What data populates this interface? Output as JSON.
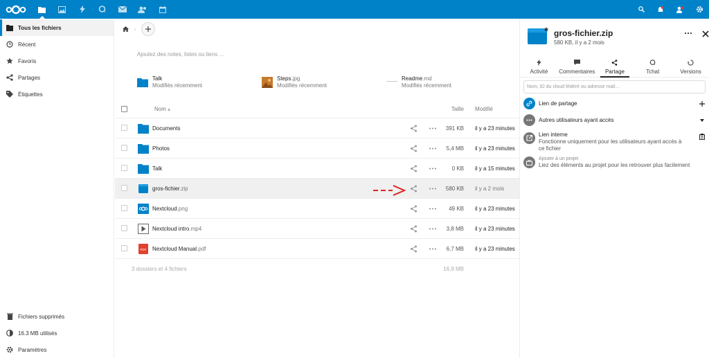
{
  "topbar": {
    "apps": [
      "files-icon",
      "photos-icon",
      "activity-icon",
      "talk-icon",
      "mail-icon",
      "contacts-icon",
      "calendar-icon"
    ],
    "colors": {
      "bar": "#0082c9"
    }
  },
  "sidebar": {
    "items": [
      {
        "label": "Tous les fichiers",
        "icon": "folder-icon"
      },
      {
        "label": "Récent",
        "icon": "clock-icon"
      },
      {
        "label": "Favoris",
        "icon": "star-icon"
      },
      {
        "label": "Partages",
        "icon": "share-icon"
      },
      {
        "label": "Étiquettes",
        "icon": "tag-icon"
      }
    ],
    "bottom": [
      {
        "label": "Fichiers supprimés",
        "icon": "trash-icon"
      },
      {
        "label": "16.3 MB utilisés",
        "icon": "quota-icon"
      },
      {
        "label": "Paramètres",
        "icon": "gear-icon"
      }
    ]
  },
  "main": {
    "notes_placeholder": "Ajoutez des notes, listes ou liens …",
    "recent": [
      {
        "name": "Talk",
        "ext": "",
        "sub": "Modifiés récemment"
      },
      {
        "name": "Steps",
        "ext": ".jpg",
        "sub": "Modifiés récemment"
      },
      {
        "name": "Readme",
        "ext": ".md",
        "sub": "Modifiés récemment"
      }
    ],
    "headers": {
      "name": "Nom",
      "size": "Taille",
      "modified": "Modifié"
    },
    "files": [
      {
        "name": "Documents",
        "ext": "",
        "size": "391 KB",
        "modified": "il y a 23 minutes"
      },
      {
        "name": "Photos",
        "ext": "",
        "size": "5,4 MB",
        "modified": "il y a 23 minutes"
      },
      {
        "name": "Talk",
        "ext": "",
        "size": "0 KB",
        "modified": "il y a 15 minutes"
      },
      {
        "name": "gros-fichier",
        "ext": ".zip",
        "size": "580 KB",
        "modified": "il y a 2 mois"
      },
      {
        "name": "Nextcloud",
        "ext": ".png",
        "size": "49 KB",
        "modified": "il y a 23 minutes"
      },
      {
        "name": "Nextcloud intro",
        "ext": ".mp4",
        "size": "3,8 MB",
        "modified": "il y a 23 minutes"
      },
      {
        "name": "Nextcloud Manual",
        "ext": ".pdf",
        "size": "6,7 MB",
        "modified": "il y a 23 minutes"
      }
    ],
    "summary": {
      "label": "3 dossiers et 4 fichiers",
      "size": "16,9 MB"
    }
  },
  "details": {
    "title": "gros-fichier.zip",
    "subtitle": "580 KB, il y a 2 mois",
    "tabs": [
      "Activité",
      "Commentaires",
      "Partage",
      "Tchat",
      "Versions"
    ],
    "share_placeholder": "Nom, ID du cloud fédéré ou adresse mail…",
    "share_link": "Lien de partage",
    "others": "Autres utilisateurs ayant accès",
    "internal_title": "Lien interne",
    "internal_sub": "Fonctionne uniquement pour les utilisateurs ayant accès à ce fichier",
    "project_title": "Ajouter à un projet",
    "project_sub": "Liez des éléments au projet pour les retrouver plus facilement"
  }
}
